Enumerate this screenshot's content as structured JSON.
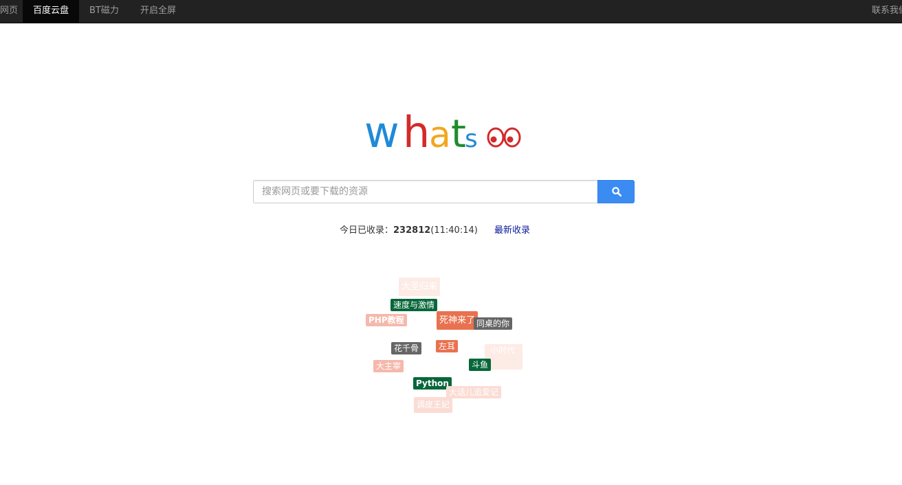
{
  "navbar": {
    "items": [
      {
        "label": "网页"
      },
      {
        "label": "百度云盘",
        "active": true
      },
      {
        "label": "BT磁力"
      },
      {
        "label": "开启全屏"
      }
    ],
    "contact": "联系我们"
  },
  "logo": {
    "text_letters": [
      "w",
      "h",
      "a",
      "t",
      "s"
    ],
    "colors": {
      "w": "#1f8ad8",
      "h": "#d42a2a",
      "a": "#f2a71b",
      "t": "#1e8c2e",
      "s": "#1f8ad8",
      "eyes": "#d42a2a"
    }
  },
  "search": {
    "placeholder": "搜索网页或要下载的资源",
    "button_icon": "search-icon",
    "button_color": "#3b8cf2"
  },
  "stats": {
    "label": "今日已收录：",
    "count": "232812",
    "time": "(11:40:14)",
    "latest_link": "最新收录"
  },
  "tags": [
    {
      "text": "大圣归来",
      "style": "faint"
    },
    {
      "text": "速度与激情",
      "style": "green"
    },
    {
      "text": "PHP教程",
      "style": "pink"
    },
    {
      "text": "死神来了",
      "style": "red"
    },
    {
      "text": "同桌的你",
      "style": "gray"
    },
    {
      "text": "花千骨",
      "style": "gray"
    },
    {
      "text": "左耳",
      "style": "red"
    },
    {
      "text": "小时代",
      "style": "faint"
    },
    {
      "text": "大主宰",
      "style": "pink"
    },
    {
      "text": "斗鱼",
      "style": "green"
    },
    {
      "text": "Python",
      "style": "green"
    },
    {
      "text": "大话儿追爱记",
      "style": "lightpink"
    },
    {
      "text": "调皮王妃",
      "style": "lightpink"
    }
  ]
}
